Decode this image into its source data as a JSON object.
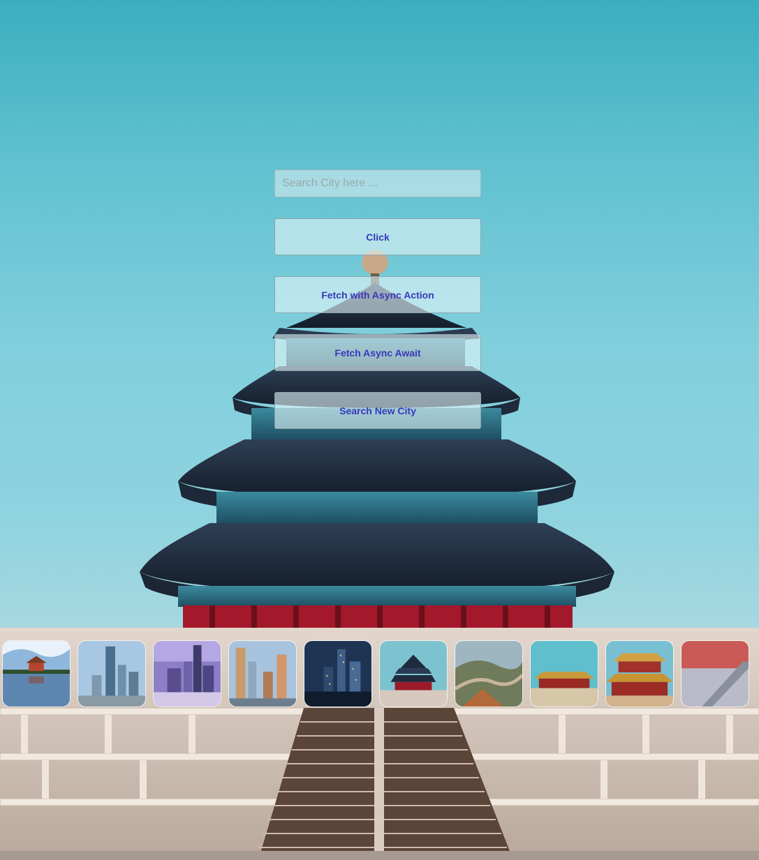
{
  "search": {
    "placeholder": "Search City here ..."
  },
  "buttons": {
    "click_label": "Click",
    "fetch_async_action_label": "Fetch with Async Action",
    "fetch_async_await_label": "Fetch Async Await",
    "search_new_city_label": "Search New City"
  },
  "colors": {
    "button_text": "#3838b8",
    "sky": "#5fc0cf"
  },
  "thumbnails": [
    {
      "subject": "palace-reflection-lake"
    },
    {
      "subject": "city-skyscrapers-day"
    },
    {
      "subject": "skyline-purple-dusk"
    },
    {
      "subject": "skyscrapers-sunset"
    },
    {
      "subject": "skyline-night"
    },
    {
      "subject": "temple-of-heaven"
    },
    {
      "subject": "great-wall"
    },
    {
      "subject": "forbidden-city-roofs"
    },
    {
      "subject": "golden-palace-roofs"
    },
    {
      "subject": "red-wall-shadow"
    }
  ]
}
